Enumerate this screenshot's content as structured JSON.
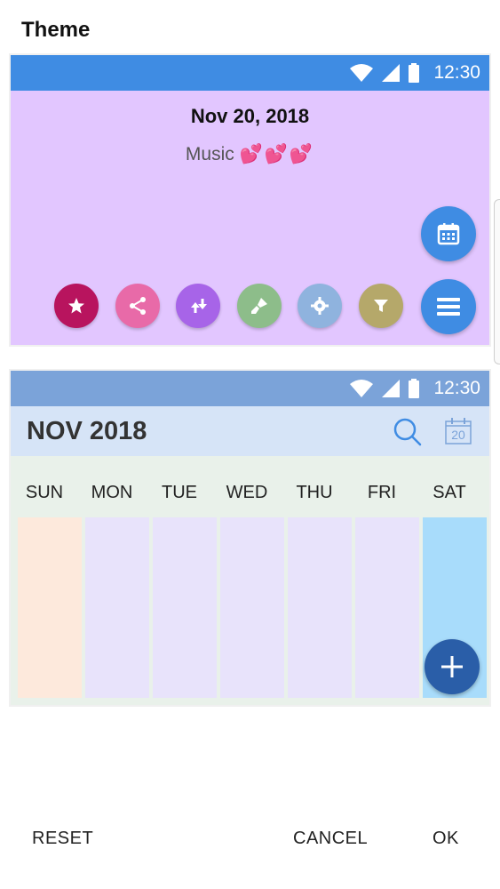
{
  "page": {
    "title": "Theme"
  },
  "preview_top": {
    "status_time": "12:30",
    "date": "Nov 20, 2018",
    "event_text": "Music",
    "event_emoji": "💕💕💕",
    "bg_color": "#e2c6ff",
    "accent": "#3f8ce3",
    "fabs": [
      {
        "icon": "star-icon",
        "color": "#b8145e"
      },
      {
        "icon": "share-icon",
        "color": "#e86aa8"
      },
      {
        "icon": "import-export-icon",
        "color": "#a764e8"
      },
      {
        "icon": "paint-brush-icon",
        "color": "#8dbd8a"
      },
      {
        "icon": "gear-icon",
        "color": "#8fb3de"
      },
      {
        "icon": "filter-icon",
        "color": "#b5a86a"
      }
    ]
  },
  "preview_bottom": {
    "status_time": "12:30",
    "month_label": "NOV 2018",
    "today_number": "20",
    "weekdays": [
      "SUN",
      "MON",
      "TUE",
      "WED",
      "THU",
      "FRI",
      "SAT"
    ],
    "column_colors": [
      "#fde9dc",
      "#e8e3fb",
      "#e8e3fb",
      "#e8e3fb",
      "#e8e3fb",
      "#e8e3fb",
      "#a8dcfb"
    ]
  },
  "actions": {
    "reset": "RESET",
    "cancel": "CANCEL",
    "ok": "OK"
  }
}
